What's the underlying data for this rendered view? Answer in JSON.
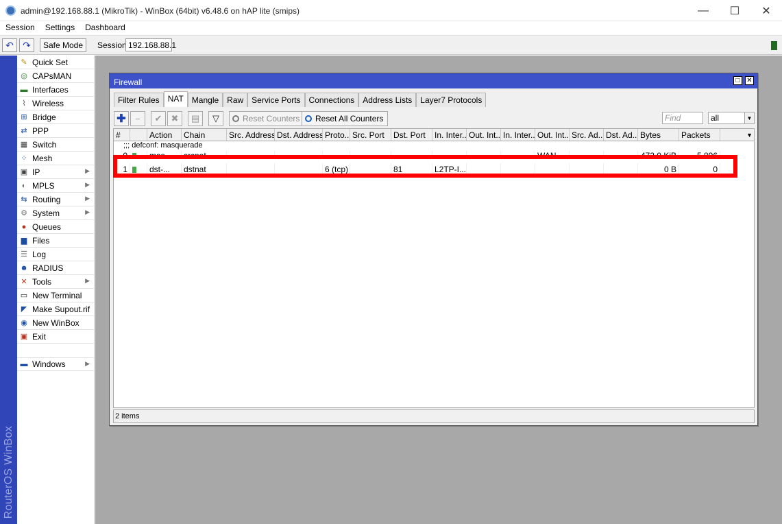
{
  "window": {
    "title": "admin@192.168.88.1 (MikroTik) - WinBox (64bit) v6.48.6 on hAP lite (smips)",
    "minimize_glyph": "—",
    "maximize_glyph": "☐",
    "close_glyph": "✕"
  },
  "menubar": [
    "Session",
    "Settings",
    "Dashboard"
  ],
  "toolbar": {
    "undo_glyph": "↶",
    "redo_glyph": "↷",
    "safe_mode": "Safe Mode",
    "session_label": "Session:",
    "session_value": "192.168.88.1"
  },
  "brand_vertical": "RouterOS WinBox",
  "sidebar": [
    {
      "label": "Quick Set",
      "icon": "wand-icon",
      "glyph": "✎"
    },
    {
      "label": "CAPsMAN",
      "icon": "capsman-icon",
      "glyph": "◎"
    },
    {
      "label": "Interfaces",
      "icon": "interfaces-icon",
      "glyph": "▬"
    },
    {
      "label": "Wireless",
      "icon": "wireless-icon",
      "glyph": "⌇"
    },
    {
      "label": "Bridge",
      "icon": "bridge-icon",
      "glyph": "⊞"
    },
    {
      "label": "PPP",
      "icon": "ppp-icon",
      "glyph": "⇄"
    },
    {
      "label": "Switch",
      "icon": "switch-icon",
      "glyph": "▦"
    },
    {
      "label": "Mesh",
      "icon": "mesh-icon",
      "glyph": "⁘"
    },
    {
      "label": "IP",
      "icon": "ip-icon",
      "glyph": "▣",
      "submenu": true
    },
    {
      "label": "MPLS",
      "icon": "mpls-icon",
      "glyph": "◐",
      "submenu": true
    },
    {
      "label": "Routing",
      "icon": "routing-icon",
      "glyph": "⇆",
      "submenu": true
    },
    {
      "label": "System",
      "icon": "system-gear-icon",
      "glyph": "⚙",
      "submenu": true
    },
    {
      "label": "Queues",
      "icon": "queues-icon",
      "glyph": "●"
    },
    {
      "label": "Files",
      "icon": "files-folder-icon",
      "glyph": "▆"
    },
    {
      "label": "Log",
      "icon": "log-icon",
      "glyph": "☰"
    },
    {
      "label": "RADIUS",
      "icon": "radius-users-icon",
      "glyph": "☻"
    },
    {
      "label": "Tools",
      "icon": "tools-icon",
      "glyph": "✕",
      "submenu": true
    },
    {
      "label": "New Terminal",
      "icon": "terminal-icon",
      "glyph": "▭"
    },
    {
      "label": "Make Supout.rif",
      "icon": "supout-icon",
      "glyph": "◤"
    },
    {
      "label": "New WinBox",
      "icon": "winbox-icon",
      "glyph": "◉"
    },
    {
      "label": "Exit",
      "icon": "exit-icon",
      "glyph": "▣"
    },
    {
      "label": "Windows",
      "icon": "windows-icon",
      "glyph": "▬",
      "submenu": true
    }
  ],
  "submenu_arrow": "▶",
  "firewall": {
    "title": "Firewall",
    "restore_glyph": "□",
    "close_glyph": "✕",
    "tabs": [
      "Filter Rules",
      "NAT",
      "Mangle",
      "Raw",
      "Service Ports",
      "Connections",
      "Address Lists",
      "Layer7 Protocols"
    ],
    "active_tab": "NAT",
    "buttons": {
      "add_glyph": "✚",
      "remove_glyph": "−",
      "enable_glyph": "✔",
      "disable_glyph": "✖",
      "comment_glyph": "▤",
      "filter_glyph": "▽",
      "reset_counters": "Reset Counters",
      "reset_all_counters": "Reset All Counters"
    },
    "find_placeholder": "Find",
    "filter_select": "all",
    "dropdown_glyph": "▼",
    "columns": [
      "#",
      "",
      "Action",
      "Chain",
      "Src. Address",
      "Dst. Address",
      "Proto...",
      "Src. Port",
      "Dst. Port",
      "In. Inter...",
      "Out. Int...",
      "In. Inter...",
      "Out. Int...",
      "Src. Ad...",
      "Dst. Ad...",
      "Bytes",
      "Packets"
    ],
    "section_comment": ";;; defconf: masquerade",
    "rows": [
      {
        "num": "0",
        "action": "mas...",
        "chain": "srcnat",
        "src_addr": "",
        "dst_addr": "",
        "proto": "",
        "src_port": "",
        "dst_port": "",
        "in_iface": "",
        "out_iface": "",
        "in_iface_list": "",
        "out_iface_list": "WAN",
        "src_addr_list": "",
        "dst_addr_list": "",
        "bytes": "472.0 KiB",
        "packets": "5 896"
      },
      {
        "num": "1",
        "action": "dst-...",
        "chain": "dstnat",
        "src_addr": "",
        "dst_addr": "",
        "proto": "6 (tcp)",
        "src_port": "",
        "dst_port": "81",
        "in_iface": "L2TP-I...",
        "out_iface": "",
        "in_iface_list": "",
        "out_iface_list": "",
        "src_addr_list": "",
        "dst_addr_list": "",
        "bytes": "0 B",
        "packets": "0"
      }
    ],
    "status": "2 items"
  },
  "colors": {
    "strip": "#2f45b8",
    "window_title": "#3d51c8",
    "highlight": "#ff0000",
    "desktop": "#a8a8a8"
  }
}
